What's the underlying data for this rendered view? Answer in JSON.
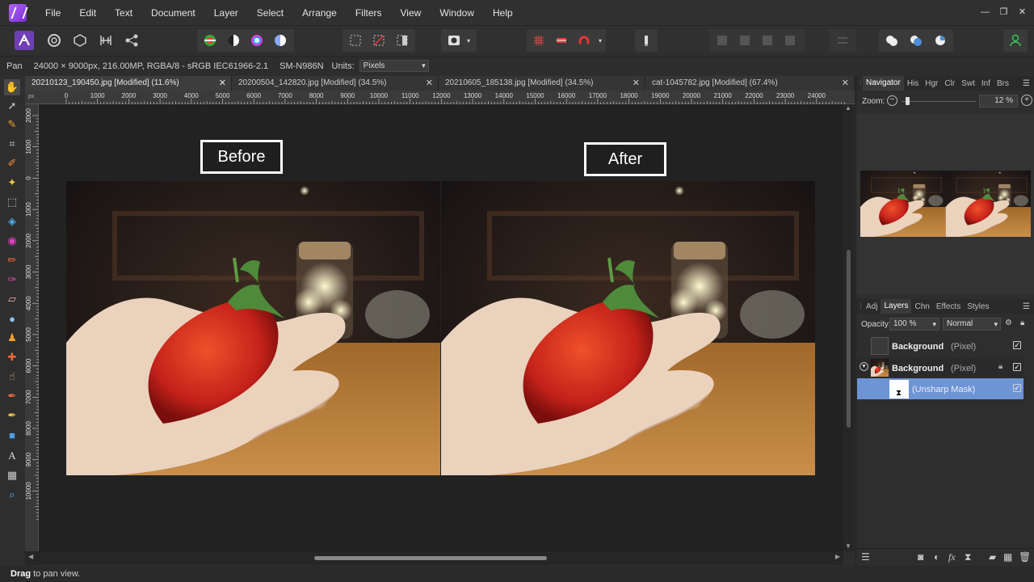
{
  "menu": [
    "File",
    "Edit",
    "Text",
    "Document",
    "Layer",
    "Select",
    "Arrange",
    "Filters",
    "View",
    "Window",
    "Help"
  ],
  "context": {
    "tool": "Pan",
    "doc_info": "24000 × 9000px, 216.00MP, RGBA/8 - sRGB IEC61966-2.1",
    "camera": "SM-N986N",
    "units_label": "Units:",
    "units_value": "Pixels"
  },
  "tabs": [
    {
      "label": "20210123_190450.jpg [Modified] (11.6%)"
    },
    {
      "label": "20200504_142820.jpg [Modified] (34.5%)"
    },
    {
      "label": "20210605_185138.jpg [Modified] (34.5%)"
    },
    {
      "label": "cat-1045782.jpg [Modified] (67.4%)"
    }
  ],
  "ruler": {
    "unit": "px",
    "top_ticks": [
      "0",
      "1000",
      "2000",
      "3000",
      "4000",
      "5000",
      "6000",
      "7000",
      "8000",
      "9000",
      "10000",
      "11000",
      "12000",
      "13000",
      "14000",
      "15000",
      "16000",
      "17000",
      "18000",
      "19000",
      "20000",
      "21000",
      "22000",
      "23000",
      "24000"
    ],
    "left_ticks": [
      "2000",
      "1000",
      "0",
      "1000",
      "2000",
      "3000",
      "4000",
      "5000",
      "6000",
      "7000",
      "8000",
      "9000",
      "10000"
    ]
  },
  "canvas": {
    "before_label": "Before",
    "after_label": "After"
  },
  "navigator": {
    "tabs": [
      "Navigator",
      "His",
      "Hgr",
      "Clr",
      "Swt",
      "Inf",
      "Brs"
    ],
    "zoom_label": "Zoom:",
    "zoom_value": "12 %"
  },
  "layers_panel": {
    "tabs": [
      "Adj",
      "Layers",
      "Chn",
      "Effects",
      "Styles"
    ],
    "opacity_label": "Opacity:",
    "opacity_value": "100 %",
    "blend_mode": "Normal",
    "layers": [
      {
        "name": "Background",
        "type": "(Pixel)"
      },
      {
        "name": "Background",
        "type": "(Pixel)"
      },
      {
        "name": "",
        "type": "(Unsharp Mask)"
      }
    ]
  },
  "status": {
    "bold": "Drag",
    "text": " to pan view."
  },
  "colors": {
    "accent": "#5a8fd8",
    "selected_layer": "#6d94d4",
    "background": "#2e2e2e"
  }
}
